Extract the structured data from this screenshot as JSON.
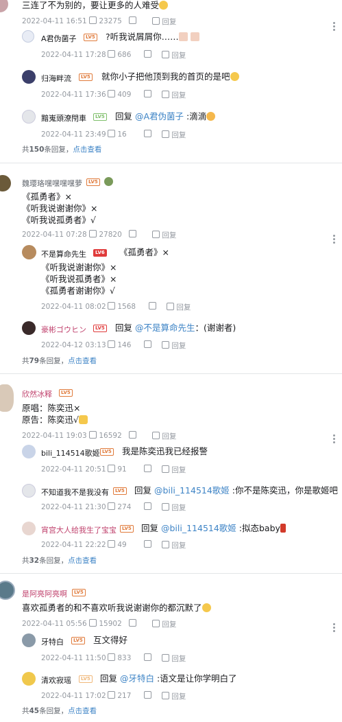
{
  "c1": {
    "text": "三连了不为别的，要让更多的人难受",
    "date": "2022-04-11 16:51",
    "likes": "23275",
    "reply": "回复",
    "r1": {
      "name": "A君伪菌子",
      "lv": "LV5",
      "text": "?听我说屑屑你……",
      "date": "2022-04-11 17:28",
      "likes": "686",
      "reply": "回复"
    },
    "r2": {
      "name": "归海畔流",
      "lv": "LV5",
      "text": "就你小子把他顶到我的首页的是吧",
      "date": "2022-04-11 17:36",
      "likes": "409",
      "reply": "回复"
    },
    "r3": {
      "name": "黯嵬頭潦閇車",
      "lv": "LV5",
      "pre": "回复 ",
      "at": "@A君伪菌子",
      "text": " :滴滴",
      "date": "2022-04-11 23:49",
      "likes": "16",
      "reply": "回复"
    },
    "more_a": "共",
    "more_n": "150",
    "more_b": "条回复，",
    "more_link": "点击查看"
  },
  "c2": {
    "name": "魏璎珞嘿嘿嘿嘿萝",
    "lv": "LV5",
    "l1": "《孤勇者》×",
    "l2": "《听我说谢谢你》×",
    "l3": "《听我说孤勇者》√",
    "date": "2022-04-11 07:28",
    "likes": "27820",
    "reply": "回复",
    "r1": {
      "name": "不是算命先生",
      "lv": "LV6",
      "t1": "《孤勇者》×",
      "t2": "《听我说谢谢你》×",
      "t3": "《听我说孤勇者》×",
      "t4": "《孤勇者谢谢你》√",
      "date": "2022-04-11 08:02",
      "likes": "1568",
      "reply": "回复"
    },
    "r2": {
      "name": "豪彬ゴウヒン",
      "lv": "LV5",
      "pre": "回复 ",
      "at": "@不是算命先生",
      "text": "：(谢谢者)",
      "date": "2022-04-12 03:13",
      "likes": "146",
      "reply": "回复"
    },
    "more_a": "共",
    "more_n": "79",
    "more_b": "条回复，",
    "more_link": "点击查看"
  },
  "c3": {
    "name": "欣然冰释",
    "lv": "LV5",
    "l1": "原唱：陈奕迅×",
    "l2": "原告：陈奕迅√",
    "date": "2022-04-11 19:03",
    "likes": "16592",
    "reply": "回复",
    "r1": {
      "name": "bili_114514歌姬",
      "lv": "LV5",
      "text": "我是陈奕迅我已经报警",
      "date": "2022-04-11 20:51",
      "likes": "91",
      "reply": "回复"
    },
    "r2": {
      "name": "不知道我不是我没有",
      "lv": "LV5",
      "pre": "回复 ",
      "at": "@bili_114514歌姬",
      "text": " :你不是陈奕迅，你是歌姬吧",
      "date": "2022-04-11 21:30",
      "likes": "274",
      "reply": "回复"
    },
    "r3": {
      "name": "宵宫大人给我生了宝宝",
      "lv": "LV5",
      "pre": "回复 ",
      "at": "@bili_114514歌姬",
      "text": " :拟态baby",
      "date": "2022-04-11 22:22",
      "likes": "49",
      "reply": "回复"
    },
    "more_a": "共",
    "more_n": "32",
    "more_b": "条回复，",
    "more_link": "点击查看"
  },
  "c4": {
    "name": "是阿亮阿亮啊",
    "lv": "LV5",
    "text": "喜欢孤勇者的和不喜欢听我说谢谢你的都沉默了",
    "date": "2022-04-11 05:56",
    "likes": "15902",
    "reply": "回复",
    "r1": {
      "name": "牙特白",
      "lv": "LV5",
      "text": "互文得好",
      "date": "2022-04-11 11:50",
      "likes": "833",
      "reply": "回复"
    },
    "r2": {
      "name": "清欢寂瑶",
      "lv": "LV5",
      "pre": "回复 ",
      "at": "@牙特白",
      "text": " :语文是让你学明白了",
      "date": "2022-04-11 17:02",
      "likes": "217",
      "reply": "回复"
    },
    "more_a": "共",
    "more_n": "45",
    "more_b": "条回复，",
    "more_link": "点击查看"
  },
  "colors": {
    "accent": "#3e84c6",
    "lv5": "#e07a3a",
    "lv6": "#e03b3b",
    "meta": "#9499a0"
  }
}
